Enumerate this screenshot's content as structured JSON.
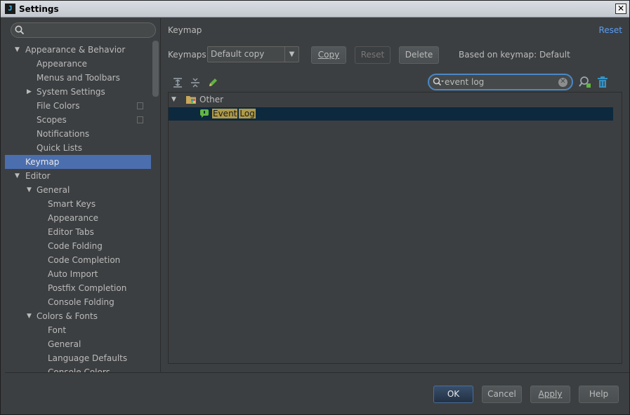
{
  "window": {
    "title": "Settings",
    "app_icon": "jetbrains-icon"
  },
  "sidebar": {
    "search_placeholder": "",
    "items": [
      {
        "label": "Appearance & Behavior",
        "level": 0,
        "expanded": true
      },
      {
        "label": "Appearance",
        "level": 1
      },
      {
        "label": "Menus and Toolbars",
        "level": 1
      },
      {
        "label": "System Settings",
        "level": 1,
        "collapsed": true
      },
      {
        "label": "File Colors",
        "level": 1,
        "project_icon": true
      },
      {
        "label": "Scopes",
        "level": 1,
        "project_icon": true
      },
      {
        "label": "Notifications",
        "level": 1
      },
      {
        "label": "Quick Lists",
        "level": 1
      },
      {
        "label": "Keymap",
        "level": 0,
        "selected": true
      },
      {
        "label": "Editor",
        "level": 0,
        "expanded": true
      },
      {
        "label": "General",
        "level": 1,
        "expanded": true
      },
      {
        "label": "Smart Keys",
        "level": 2
      },
      {
        "label": "Appearance",
        "level": 2
      },
      {
        "label": "Editor Tabs",
        "level": 2
      },
      {
        "label": "Code Folding",
        "level": 2
      },
      {
        "label": "Code Completion",
        "level": 2
      },
      {
        "label": "Auto Import",
        "level": 2
      },
      {
        "label": "Postfix Completion",
        "level": 2
      },
      {
        "label": "Console Folding",
        "level": 2
      },
      {
        "label": "Colors & Fonts",
        "level": 1,
        "expanded": true
      },
      {
        "label": "Font",
        "level": 2
      },
      {
        "label": "General",
        "level": 2
      },
      {
        "label": "Language Defaults",
        "level": 2
      },
      {
        "label": "Console Colors",
        "level": 2
      }
    ]
  },
  "panel": {
    "heading": "Keymap",
    "reset_link": "Reset",
    "keymaps_label": "Keymaps:",
    "keymap_selected": "Default copy",
    "copy_btn": "Copy",
    "reset_btn": "Reset",
    "delete_btn": "Delete",
    "based_on": "Based on keymap: Default",
    "filter_text": "event log",
    "tree": {
      "group": "Other",
      "action_word1": "Event",
      "action_word2": "Log"
    }
  },
  "footer": {
    "ok": "OK",
    "cancel": "Cancel",
    "apply": "Apply",
    "help": "Help"
  },
  "colors": {
    "background": "#3c3f41",
    "selection": "#4b6eaf",
    "tree_selection": "#0d293e",
    "highlight": "#ae9a4a",
    "link": "#589df6"
  }
}
